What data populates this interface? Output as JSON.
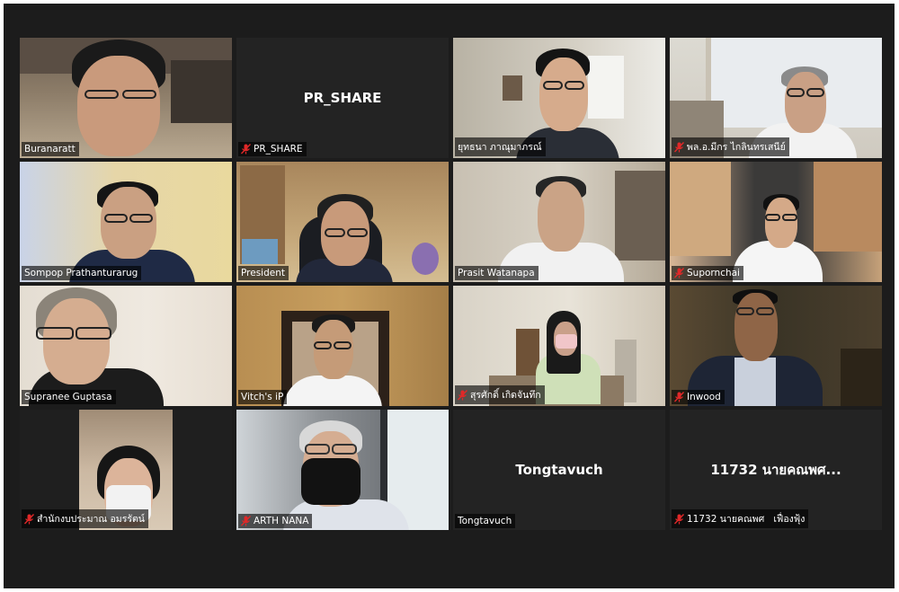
{
  "meeting": {
    "participants": [
      {
        "name": "Buranaratt",
        "muted": false,
        "center_text": ""
      },
      {
        "name": "PR_SHARE",
        "muted": true,
        "center_text": "PR_SHARE"
      },
      {
        "name": "ยุทธนา ภาณุมาภรณ์",
        "muted": false,
        "center_text": ""
      },
      {
        "name": "พล.อ.มีกร ไกลินทรเสนีย์",
        "muted": true,
        "center_text": ""
      },
      {
        "name": "Sompop Prathanturarug",
        "muted": false,
        "center_text": ""
      },
      {
        "name": "President",
        "muted": false,
        "center_text": ""
      },
      {
        "name": "Prasit Watanapa",
        "muted": false,
        "center_text": ""
      },
      {
        "name": "Supornchai",
        "muted": true,
        "center_text": ""
      },
      {
        "name": "Supranee Guptasa",
        "muted": false,
        "center_text": ""
      },
      {
        "name": "Vitch's iP",
        "muted": false,
        "center_text": ""
      },
      {
        "name": "สุรศักดิ์ เกิดจันทึก",
        "muted": true,
        "center_text": ""
      },
      {
        "name": "Inwood",
        "muted": true,
        "center_text": ""
      },
      {
        "name": "สำนักงบประมาณ อมรรัตน์",
        "muted": true,
        "center_text": ""
      },
      {
        "name": "ARTH NANA",
        "muted": true,
        "center_text": ""
      },
      {
        "name": "Tongtavuch",
        "muted": false,
        "center_text": "Tongtavuch"
      },
      {
        "name": "11732 นายคณพศ   เฟื่องฟุ้ง",
        "muted": true,
        "center_text": "11732 นายคณพศ..."
      }
    ],
    "active_speaker": "President",
    "colors": {
      "background": "#1c1c1c",
      "tile_empty": "#232323",
      "active_border": "#a9d63a",
      "mic_muted": "#e02828"
    }
  }
}
